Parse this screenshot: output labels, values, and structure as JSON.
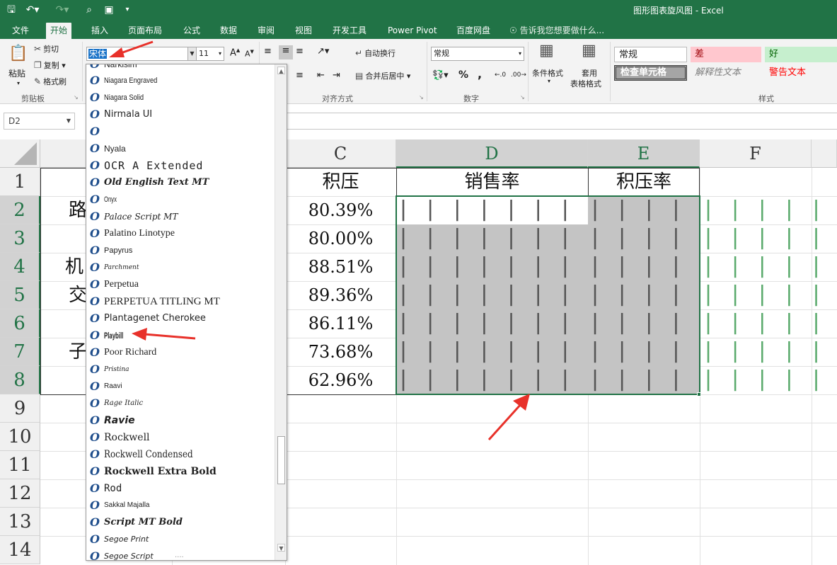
{
  "titlebar": {
    "title": "图形图表旋风图 - Excel",
    "save_icon": "floppy-disk-icon",
    "undo_icon": "undo-icon",
    "redo_icon": "redo-icon",
    "preview_icon": "print-preview-icon",
    "camera_icon": "camera-icon"
  },
  "tabs": [
    "文件",
    "开始",
    "插入",
    "页面布局",
    "公式",
    "数据",
    "审阅",
    "视图",
    "开发工具",
    "Power Pivot",
    "百度网盘"
  ],
  "active_tab": "开始",
  "tellme": "告诉我您想要做什么...",
  "ribbon": {
    "clipboard": {
      "paste": "粘贴",
      "cut": "剪切",
      "copy": "复制",
      "format_painter": "格式刷",
      "label": "剪贴板"
    },
    "font": {
      "name": "宋体",
      "size": "11",
      "grow": "A",
      "shrink": "A"
    },
    "alignment": {
      "wrap": "自动换行",
      "merge": "合并后居中",
      "label": "对齐方式"
    },
    "number": {
      "format": "常规",
      "percent": "%",
      "comma": ",",
      "label": "数字"
    },
    "cond_format": "条件格式",
    "table_format_1": "套用",
    "table_format_2": "表格格式",
    "styles": {
      "normal": "常规",
      "bad": "差",
      "good": "好",
      "check": "检查单元格",
      "explanatory": "解释性文本",
      "warning": "警告文本",
      "label": "样式"
    },
    "colors": {
      "accent": "#217346",
      "bad_bg": "#ffc7ce",
      "bad_fg": "#9c0006",
      "good_bg": "#c6efce",
      "good_fg": "#006100",
      "warning_fg": "#ff0000"
    }
  },
  "namebox": "D2",
  "columns": [
    "C",
    "D",
    "E",
    "F"
  ],
  "rows": [
    "1",
    "2",
    "3",
    "4",
    "5",
    "6",
    "7",
    "8",
    "9",
    "10",
    "11",
    "12",
    "13",
    "14"
  ],
  "headers": {
    "c1": "积压",
    "d1": "销售率",
    "e1": "积压率"
  },
  "col_a_fragments": [
    "路",
    "机",
    "交",
    "子"
  ],
  "pct_values": [
    "80.39%",
    "80.00%",
    "88.51%",
    "89.36%",
    "86.11%",
    "73.68%",
    "62.96%"
  ],
  "bars_d": [
    "| | | | | | | | | | | | | | |",
    "| | | | | | | | | | | | | | | |",
    "| | | | | | | | |",
    "| | | | | | | |",
    "| | | | | | | | | | | |",
    "| | | | | | | | | | | | | | |",
    "| | | | | | | | | | | | | | | |"
  ],
  "bars_e": [
    "| | | | | | | | |",
    "| | | | | | | | |",
    "| | | | | | | | |",
    "| | | | | | | |",
    "| | | | | | | | |",
    "| | | | | | | | |",
    "| | | | | | | | | |"
  ],
  "bars_f": [
    "| | | | | | | | | | | | | | | | | | |",
    "| | | | | | | | | | | | | | | | | | |",
    "| | | | | | | | | | | | | | | | | | |",
    "| | | | | | | | | | | | | | | | | | | |",
    "| | | | | | | | | | | | | | | | | | |",
    "| | | | | | | | | | | | | | | | | | | |",
    "| | | | | | | | | | | | | | | | | | |"
  ],
  "font_list": [
    "Niagara Engraved",
    "Niagara Solid",
    "Nirmala UI",
    "",
    "Nyala",
    "OCR A Extended",
    "Old English Text MT",
    "Onyx",
    "Palace Script MT",
    "Palatino Linotype",
    "Papyrus",
    "Parchment",
    "Perpetua",
    "PERPETUA TITLING MT",
    "Plantagenet Cherokee",
    "Playbill",
    "Poor Richard",
    "Pristina",
    "Raavi",
    "Rage Italic",
    "Ravie",
    "Rockwell",
    "Rockwell Condensed",
    "Rockwell Extra Bold",
    "Rod",
    "Sakkal Majalla",
    "Script MT Bold",
    "Segoe Print"
  ],
  "font_list_partial_top": "Narkisim",
  "font_list_partial_bottom": "Segoe Script",
  "font_item_icon": "opentype-font-icon",
  "dropdown_grip": "....",
  "annotation_color": "#e8312a"
}
